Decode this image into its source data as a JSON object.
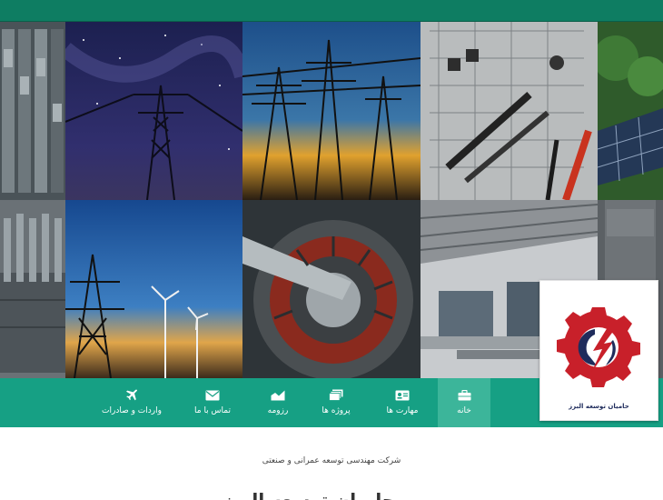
{
  "nav": {
    "items": [
      {
        "label": "خانه",
        "icon": "briefcase-icon",
        "active": true
      },
      {
        "label": "مهارت ها",
        "icon": "id-card-icon",
        "active": false
      },
      {
        "label": "پروژه ها",
        "icon": "stacked-images-icon",
        "active": false
      },
      {
        "label": "رزومه",
        "icon": "area-chart-icon",
        "active": false
      },
      {
        "label": "تماس با ما",
        "icon": "envelope-icon",
        "active": false
      },
      {
        "label": "واردات و صادرات",
        "icon": "airplane-icon",
        "active": false
      }
    ]
  },
  "logo": {
    "caption": "حامیان توسعه البرز"
  },
  "intro": {
    "company_line": "شرکت مهندسی توسعه عمرانی و صنعتی",
    "headline": "حامیان توسعه البرز"
  },
  "colors": {
    "top_bar": "#0e7d62",
    "nav_bg": "#16a084",
    "nav_active": "#3cb59a",
    "logo_red": "#c8202a",
    "logo_navy": "#1f2c5c"
  }
}
